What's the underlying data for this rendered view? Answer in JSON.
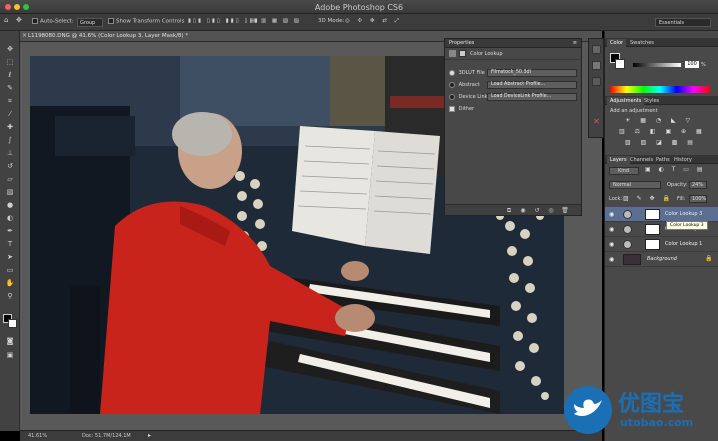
{
  "window": {
    "title": "Adobe Photoshop CS6"
  },
  "options_bar": {
    "auto_select_label": "Auto-Select:",
    "auto_select_value": "Group",
    "show_transform_label": "Show Transform Controls",
    "mode_3d_label": "3D Mode:",
    "workspace_value": "Essentials"
  },
  "document": {
    "tab_title": "L1198080.DNG @ 41.6% (Color Lookup 3, Layer Mask/8) *"
  },
  "status_bar": {
    "zoom": "41.61%",
    "doc_size": "Doc: 51.7M/124.1M"
  },
  "properties_panel": {
    "header": "Properties",
    "title": "Color Lookup",
    "rows": [
      {
        "label": "3DLUT File",
        "value": "Filmstock_50.3dl",
        "checked": true
      },
      {
        "label": "Abstract",
        "value": "Load Abstract Profile...",
        "checked": false
      },
      {
        "label": "Device Link",
        "value": "Load DeviceLink Profile...",
        "checked": false
      }
    ],
    "dither_label": "Dither"
  },
  "color_panel": {
    "tabs": [
      "Color",
      "Swatches"
    ],
    "slider_value": "100",
    "slider_unit": "%"
  },
  "adjustments_panel": {
    "tabs": [
      "Adjustments",
      "Styles"
    ],
    "add_label": "Add an adjustment"
  },
  "layers_panel": {
    "tabs": [
      "Layers",
      "Channels",
      "Paths",
      "History"
    ],
    "kind_filter": "Kind",
    "blend_mode": "Normal",
    "opacity_label": "Opacity:",
    "opacity_value": "24%",
    "lock_label": "Lock:",
    "fill_label": "Fill:",
    "fill_value": "100%",
    "layers": [
      {
        "name": "Color Lookup 3",
        "selected": true
      },
      {
        "name": "Color Lookup 2",
        "selected": false
      },
      {
        "name": "Color Lookup 1",
        "selected": false
      },
      {
        "name": "Background",
        "selected": false
      }
    ],
    "tooltip": "Color Lookup 3"
  },
  "watermark": {
    "brand": "优图宝",
    "url": "utobao.com"
  },
  "icons": {
    "tools": [
      "move-icon",
      "marquee-icon",
      "lasso-icon",
      "quick-select-icon",
      "crop-icon",
      "eyedropper-icon",
      "healing-icon",
      "brush-icon",
      "stamp-icon",
      "history-brush-icon",
      "eraser-icon",
      "gradient-icon",
      "blur-icon",
      "dodge-icon",
      "pen-icon",
      "type-icon",
      "path-select-icon",
      "shape-icon",
      "hand-icon",
      "zoom-icon"
    ]
  },
  "colors": {
    "chrome": "#3c3c3c",
    "panel": "#494949",
    "selected_layer": "#5a6f91",
    "watermark_blue": "#1a6fb5"
  }
}
